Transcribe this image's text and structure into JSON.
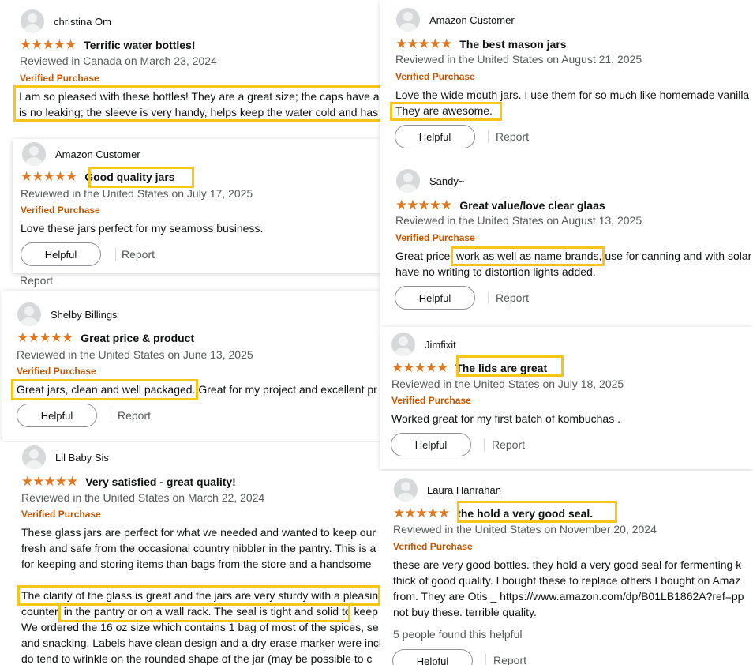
{
  "stars_glyph": "★★★★★",
  "colors": {
    "star": "#de7921",
    "verified": "#c45500",
    "highlight": "#f5c518",
    "meta": "#565959"
  },
  "icons": {
    "avatar": "user-silhouette-icon",
    "star": "star-icon"
  },
  "reviews": [
    {
      "user": "christina Om",
      "title": "Terrific water bottles!",
      "meta": "Reviewed in Canada on March 23, 2024",
      "verified": "Verified Purchase",
      "body": [
        "I am so pleased with these bottles! They are a great size; the caps have a",
        "is no leaking; the sleeve is very handy, helps keep the water cold and has"
      ]
    },
    {
      "user": "Amazon Customer",
      "title": "Good quality jars",
      "meta": "Reviewed in the United States on July 17, 2025",
      "verified": "Verified Purchase",
      "body": [
        "Love these jars perfect for my seamoss business."
      ],
      "helpful": "Helpful",
      "report": "Report"
    },
    {
      "stray_report": "Report"
    },
    {
      "user": "Shelby Billings",
      "title": "Great price & product",
      "meta": "Reviewed in the United States on June 13, 2025",
      "verified": "Verified Purchase",
      "body_hl": "Great jars, clean and well packaged.",
      "body_rest": " Great for my project and excellent pr",
      "helpful": "Helpful",
      "report": "Report"
    },
    {
      "user": "Lil Baby Sis",
      "title": "Very satisfied - great quality!",
      "meta": "Reviewed in the United States on March 22, 2024",
      "verified": "Verified Purchase",
      "body": [
        "These glass jars are perfect for what we needed and wanted to keep our",
        "fresh and safe from the occasional country nibbler in the pantry. This is a",
        "for keeping and storing items than bags from the store and a handsome"
      ],
      "body2": [
        "The clarity of the glass is great and the jars are very sturdy with a pleasin",
        "counter, in the pantry or on a wall rack. The seal is tight and solid to keep",
        "We ordered the 16 oz size which contains 1 bag of most of the spices, se",
        "and snacking. Labels have clean design and a dry erase marker were inclu",
        "do tend to wrinkle on the rounded shape of the jar (may be possible to c"
      ]
    },
    {
      "user": "Amazon Customer",
      "title": "The best mason jars",
      "meta": "Reviewed in the United States on August 21, 2025",
      "verified": "Verified Purchase",
      "body": [
        "Love the wide mouth jars. I use them for so much like homemade vanilla",
        "They are awesome."
      ],
      "helpful": "Helpful",
      "report": "Report"
    },
    {
      "user": "Sandy~",
      "title": "Great value/love clear glaas",
      "meta": "Reviewed in the United States on August 13, 2025",
      "verified": "Verified Purchase",
      "body": [
        "Great price, work as well as name brands, use for canning and with solar",
        "have no writing to distortion lights added."
      ],
      "helpful": "Helpful",
      "report": "Report"
    },
    {
      "user": "Jimfixit",
      "title": "The lids are great",
      "meta": "Reviewed in the United States on July 18, 2025",
      "verified": "Verified Purchase",
      "body": [
        "Worked great for my first batch of kombuchas ."
      ],
      "helpful": "Helpful",
      "report": "Report"
    },
    {
      "user": "Laura Hanrahan",
      "title": "the hold a very good seal.",
      "meta": "Reviewed in the United States on November 20, 2024",
      "verified": "Verified Purchase",
      "body": [
        "these are very good bottles. they hold a very good seal for fermenting k",
        "thick of good quality. I bought these to replace others I bought on Amaz",
        "from. They are Otis _ https://www.amazon.com/dp/B01LB1862A?ref=pp",
        "not buy these. terrible quality."
      ],
      "helpful_count": "5 people found this helpful",
      "helpful": "Helpful",
      "report": "Report"
    }
  ]
}
